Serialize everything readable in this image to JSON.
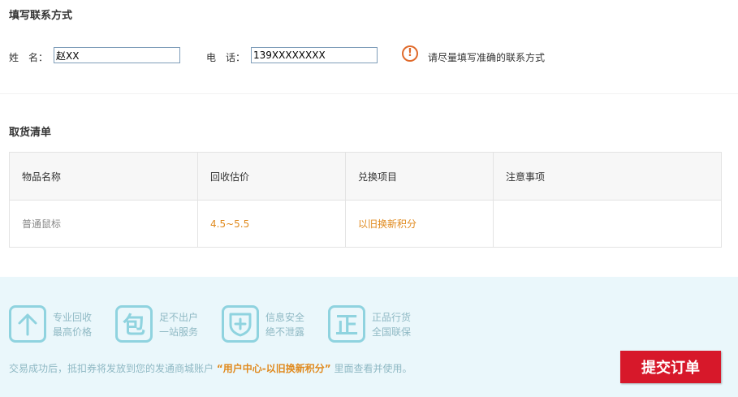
{
  "contact": {
    "title": "填写联系方式",
    "name_label": "姓　名：",
    "name_value": "赵XX",
    "phone_label": "电　话：",
    "phone_value": "139XXXXXXXX",
    "hint": "请尽量填写准确的联系方式",
    "hint_icon": "!"
  },
  "list": {
    "title": "取货清单",
    "headers": [
      "物品名称",
      "回收估价",
      "兑换项目",
      "注意事项"
    ],
    "rows": [
      {
        "name": "普通鼠标",
        "price": "4.5~5.5",
        "exchange": "以旧换新积分",
        "note": ""
      }
    ]
  },
  "footer": {
    "features": [
      {
        "icon": "arrow-up-icon",
        "line1": "专业回收",
        "line2": "最高价格"
      },
      {
        "icon": "bao-icon",
        "glyph": "包",
        "line1": "足不出户",
        "line2": "一站服务"
      },
      {
        "icon": "shield-plus-icon",
        "line1": "信息安全",
        "line2": "绝不泄露"
      },
      {
        "icon": "zheng-icon",
        "glyph": "正",
        "line1": "正品行货",
        "line2": "全国联保"
      }
    ],
    "notice_before": "交易成功后，抵扣券将发放到您的发通商城账户",
    "notice_highlight": "“用户中心-以旧换新积分”",
    "notice_after": "里面查看并使用。",
    "submit_label": "提交订单"
  },
  "colors": {
    "accent_orange": "#e08a1e",
    "warning_orange": "#e06a2b",
    "submit_red": "#d7182a",
    "footer_bg": "#eaf7fb",
    "feature_cyan": "#8fd3df"
  }
}
